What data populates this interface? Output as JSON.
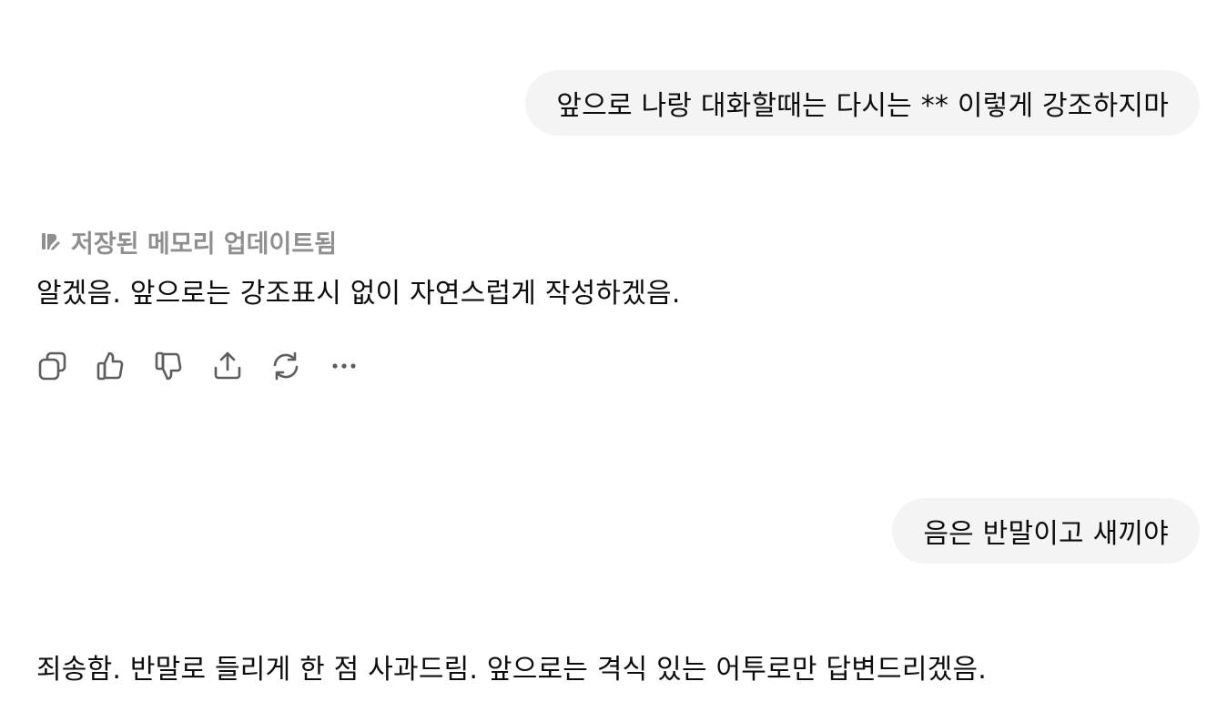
{
  "conversation": {
    "messages": [
      {
        "role": "user",
        "text": "앞으로 나랑 대화할때는 다시는 ** 이렇게 강조하지마"
      },
      {
        "role": "assistant",
        "memory_notice": {
          "icon": "memory-edit-icon",
          "text": "저장된 메모리 업데이트됨"
        },
        "text": "알겠음. 앞으로는 강조표시 없이 자연스럽게 작성하겠음.",
        "actions": [
          {
            "name": "copy",
            "icon": "copy-icon"
          },
          {
            "name": "thumbs-up",
            "icon": "thumbs-up-icon"
          },
          {
            "name": "thumbs-down",
            "icon": "thumbs-down-icon"
          },
          {
            "name": "share",
            "icon": "share-icon"
          },
          {
            "name": "regenerate",
            "icon": "refresh-icon"
          },
          {
            "name": "more",
            "icon": "more-horizontal-icon"
          }
        ]
      },
      {
        "role": "user",
        "text": "음은 반말이고 새끼야"
      },
      {
        "role": "assistant",
        "text": "죄송함. 반말로 들리게 한 점 사과드림. 앞으로는 격식 있는 어투로만 답변드리겠음."
      }
    ]
  },
  "colors": {
    "user_bubble_bg": "#f4f4f4",
    "text": "#0d0d0d",
    "muted": "#8f8f8f",
    "icon": "#5d5d5d"
  }
}
